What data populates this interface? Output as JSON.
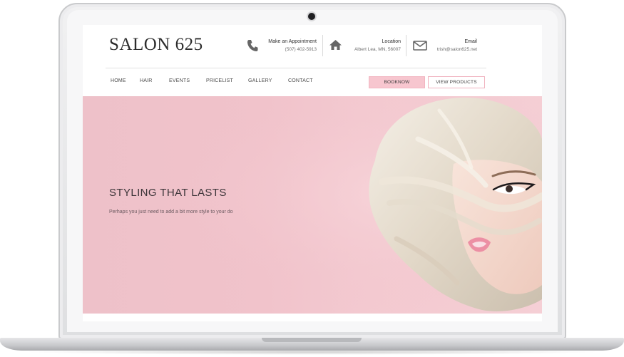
{
  "site": {
    "logo": "SALON 625",
    "contacts": [
      {
        "label": "Make an Appointment",
        "value": "(507) 402-5913",
        "icon": "phone-icon"
      },
      {
        "label": "Location",
        "value": "Albert Lea, MN, 56007",
        "icon": "home-icon"
      },
      {
        "label": "Email",
        "value": "trish@salon625.net",
        "icon": "envelope-icon"
      }
    ]
  },
  "nav": {
    "items": [
      "HOME",
      "HAIR",
      "EVENTS",
      "PRICELIST",
      "GALLERY",
      "CONTACT"
    ]
  },
  "buttons": {
    "book": "BOOKNOW",
    "products": "VIEW PRODUCTS"
  },
  "hero": {
    "title": "STYLING THAT LASTS",
    "subtitle": "Perhaps you just need to add a bit more style to your do",
    "image": "woman-with-platinum-bob-hair"
  },
  "colors": {
    "accent_pink": "#f7c6cf",
    "hero_bg": "#f1c3cb",
    "text_dark": "#2c2c2c"
  }
}
